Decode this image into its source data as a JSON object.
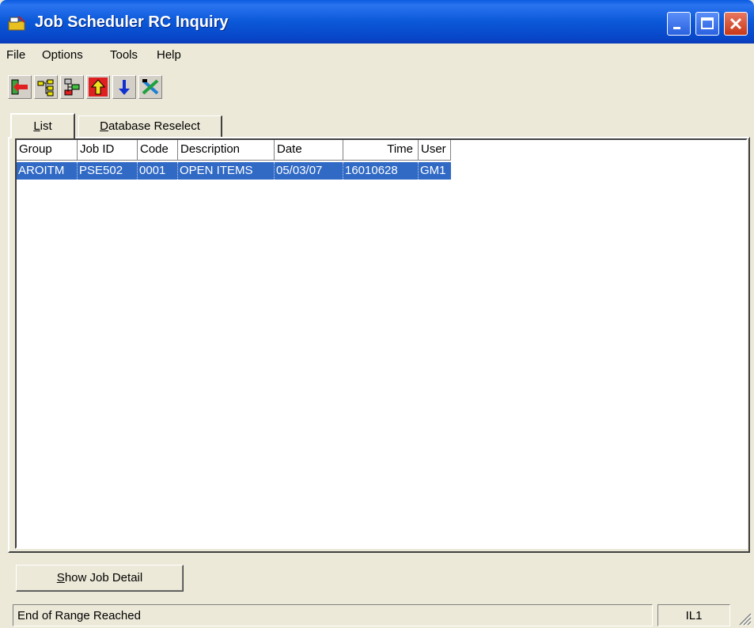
{
  "window": {
    "title": "Job Scheduler RC Inquiry",
    "icon": "scheduler-app-icon"
  },
  "menu": [
    "File",
    "Options",
    "Tools",
    "Help"
  ],
  "toolbar": {
    "buttons": [
      "exit-icon",
      "tree-icon",
      "tree-alt-icon",
      "up-arrow-icon",
      "down-arrow-icon",
      "tools-icon"
    ]
  },
  "tabs": {
    "list": {
      "accel": "L",
      "rest": "ist"
    },
    "db": {
      "accel": "D",
      "rest": "atabase Reselect"
    }
  },
  "list": {
    "headers": [
      "Group",
      "Job ID",
      "Code",
      "Description",
      "Date",
      "Time",
      "User"
    ],
    "rows": [
      [
        "AROITM",
        "PSE502",
        "0001",
        "OPEN ITEMS",
        "05/03/07",
        "16010628",
        "GM1"
      ]
    ],
    "selected_row_color": "#316ac5"
  },
  "button": {
    "accel": "S",
    "rest": "how Job Detail"
  },
  "status": {
    "message": "End of Range Reached",
    "code": "IL1"
  }
}
